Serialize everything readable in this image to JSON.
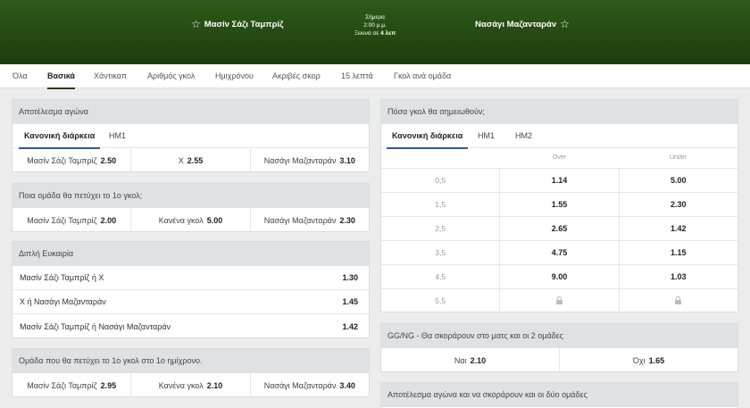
{
  "header": {
    "home_team": "Μασίν Σάζι Ταμπρίζ",
    "away_team": "Νασάγι Μαζανταράν",
    "date": "Σήμερα",
    "time": "2:00 μ.μ.",
    "starts_prefix": "Ξεκινά σε",
    "starts_in": "4 λεπ"
  },
  "tabs": [
    "Όλα",
    "Βασικά",
    "Χάντικαπ",
    "Αριθμός γκολ",
    "Ημιχρόνου",
    "Ακριβές σκορ",
    "15 λεπτά",
    "Γκολ ανά ομάδα"
  ],
  "active_tab": "Βασικά",
  "match_result": {
    "title": "Αποτέλεσμα αγώνα",
    "subtabs": [
      "Κανονική διάρκεια",
      "ΗΜ1"
    ],
    "outcomes": [
      {
        "label": "Μασίν Σάζι Ταμπρίζ",
        "odd": "2.50"
      },
      {
        "label": "Χ",
        "odd": "2.55"
      },
      {
        "label": "Νασάγι Μαζανταράν",
        "odd": "3.10"
      }
    ]
  },
  "first_goal": {
    "title": "Ποια ομάδα θα πετύχει το 1ο γκολ;",
    "outcomes": [
      {
        "label": "Μασίν Σάζι Ταμπρίζ",
        "odd": "2.00"
      },
      {
        "label": "Κανένα γκολ",
        "odd": "5.00"
      },
      {
        "label": "Νασάγι Μαζανταράν",
        "odd": "2.30"
      }
    ]
  },
  "double_chance": {
    "title": "Διπλή Ευκαιρία",
    "outcomes": [
      {
        "label": "Μασίν Σάζι Ταμπρίζ ή Χ",
        "odd": "1.30"
      },
      {
        "label": "Χ ή Νασάγι Μαζανταράν",
        "odd": "1.45"
      },
      {
        "label": "Μασίν Σάζι Ταμπρίζ ή Νασάγι Μαζανταράν",
        "odd": "1.42"
      }
    ]
  },
  "first_half_goal": {
    "title": "Ομάδα που θα πετύχει το 1ο γκολ στο 1ο ημίχρονο.",
    "outcomes": [
      {
        "label": "Μασίν Σάζι Ταμπρίζ",
        "odd": "2.95"
      },
      {
        "label": "Κανένα γκολ",
        "odd": "2.10"
      },
      {
        "label": "Νασάγι Μαζανταράν",
        "odd": "3.40"
      }
    ]
  },
  "total_goals": {
    "title": "Πόσα γκολ θα σημειωθούν;",
    "subtabs": [
      "Κανονική διάρκεια",
      "ΗΜ1",
      "ΗΜ2"
    ],
    "over_label": "Over",
    "under_label": "Under",
    "rows": [
      {
        "line": "0,5",
        "over": "1.14",
        "under": "5.00"
      },
      {
        "line": "1,5",
        "over": "1.55",
        "under": "2.30"
      },
      {
        "line": "2,5",
        "over": "2.65",
        "under": "1.42"
      },
      {
        "line": "3,5",
        "over": "4.75",
        "under": "1.15"
      },
      {
        "line": "4,5",
        "over": "9.00",
        "under": "1.03"
      },
      {
        "line": "5,5",
        "over": "",
        "under": ""
      }
    ]
  },
  "btts": {
    "title": "GG/NG - Θα σκοράρουν στο ματς και οι 2 ομάδες",
    "outcomes": [
      {
        "label": "Ναι",
        "odd": "2.10"
      },
      {
        "label": "Όχι",
        "odd": "1.65"
      }
    ]
  },
  "result_btts": {
    "title": "Αποτέλεσμα αγώνα και να σκοράρουν και οι δύο ομάδες"
  },
  "colors": {
    "header_green": "#244a12",
    "tab_underline": "#1d3f0e",
    "subtab_underline": "#2c5c8a"
  }
}
